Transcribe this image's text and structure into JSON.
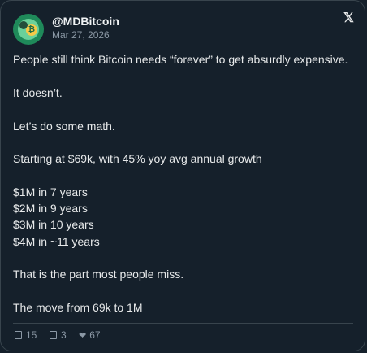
{
  "author": {
    "handle": "@MDBitcoin",
    "date": "Mar 27, 2026",
    "avatar_symbol": "₿"
  },
  "brand": {
    "x_logo": "𝕏"
  },
  "post": {
    "lines": [
      "People still think Bitcoin needs “forever” to get absurdly expensive.",
      "It doesn’t.",
      "Let’s do some math.",
      "Starting at $69k, with 45% yoy avg annual growth",
      "$1M in 7 years",
      "$2M in 9 years",
      "$3M in 10 years",
      "$4M in ~11 years",
      "That is the part most people miss.",
      "The move from 69k to 1M"
    ]
  },
  "actions": {
    "replies": "15",
    "reposts": "3",
    "likes": "67"
  },
  "colors": {
    "background": "#15202b",
    "border": "#38444d",
    "text": "#e7e9ea",
    "muted": "#8b98a5",
    "avatar": "#1f8a5a"
  }
}
